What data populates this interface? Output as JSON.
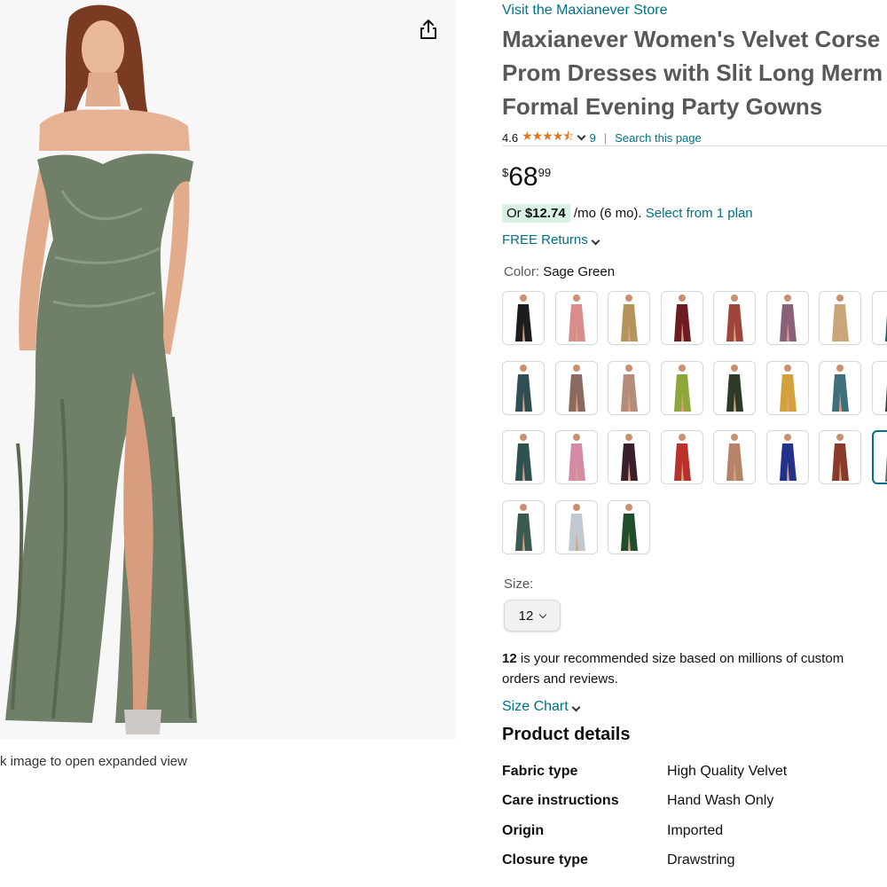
{
  "image_panel": {
    "hint_text": "k image to open expanded view",
    "share_icon": "share-icon"
  },
  "product": {
    "store_link": "Visit the Maxianever Store",
    "title_lines": [
      "Maxianever Women's Velvet Corse",
      "Prom Dresses with Slit Long Merm",
      "Formal Evening Party Gowns"
    ],
    "rating": "4.6",
    "stars": "★★★★⯪",
    "rating_count": "9",
    "rating_separator": "|",
    "search_link": "Search this page",
    "price": {
      "symbol": "$",
      "whole": "68",
      "fraction": "99"
    },
    "plan": {
      "prefix": "Or ",
      "amount": "$12.74",
      "suffix": " /mo (6 mo). ",
      "link": "Select from 1 plan"
    },
    "free_returns": "FREE Returns"
  },
  "color": {
    "label": "Color: ",
    "selected": "Sage Green",
    "swatch_colors": [
      "#1c1c1c",
      "#d98c8c",
      "#b5935a",
      "#6e1b23",
      "#a0453a",
      "#8a6178",
      "#c8a67a",
      "#1d5d6a",
      "#2f4d55",
      "#8a6a5e",
      "#b58c7a",
      "#8fa63a",
      "#2b3b26",
      "#d4a03a",
      "#3f6f7a",
      "#2e4030",
      "#2f5050",
      "#d48aa6",
      "#3a1f2e",
      "#b8322a",
      "#b58468",
      "#22318c",
      "#8a3a2a",
      "#556e66",
      "#3a5a50",
      "#c0c8d0",
      "#1f4f2a"
    ]
  },
  "size": {
    "label": "Size:",
    "selected": "12",
    "recommend_bold": "12",
    "recommend_rest": " is your recommended size based on millions of custom",
    "recommend_line2": "orders and reviews.",
    "chart_link": "Size Chart"
  },
  "product_details": {
    "title": "Product details",
    "rows": [
      {
        "key": "Fabric type",
        "value": "High Quality Velvet"
      },
      {
        "key": "Care instructions",
        "value": "Hand Wash Only"
      },
      {
        "key": "Origin",
        "value": "Imported"
      },
      {
        "key": "Closure type",
        "value": "Drawstring"
      }
    ]
  }
}
